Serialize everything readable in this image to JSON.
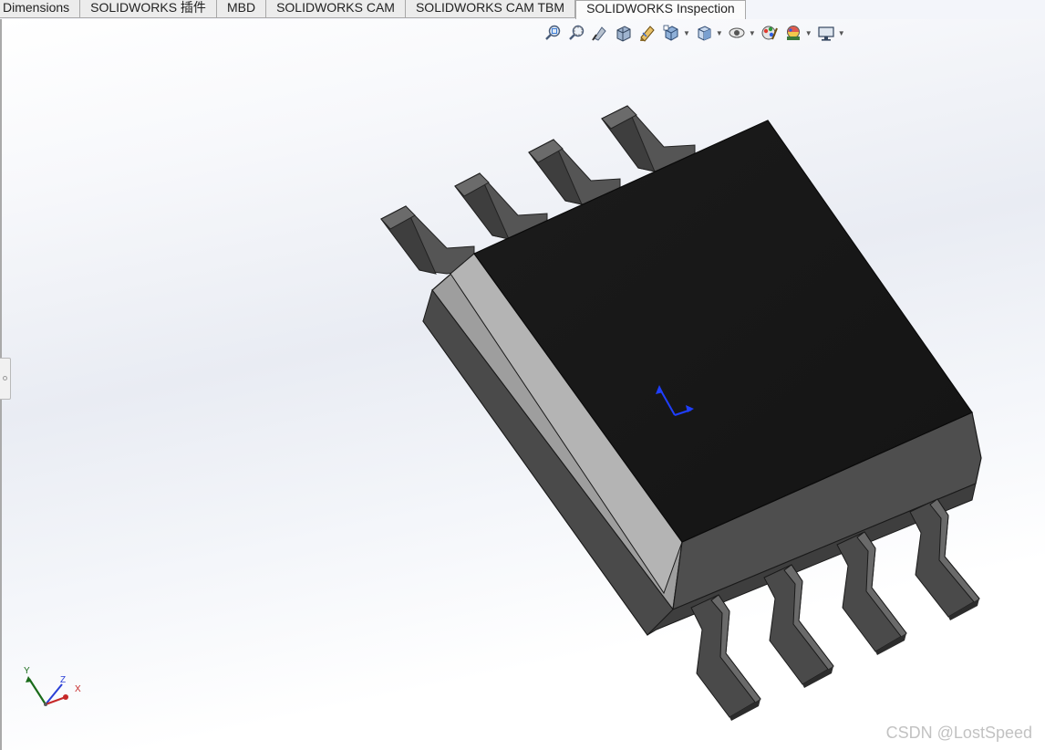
{
  "tabs": [
    {
      "label": "Dimensions",
      "active": false
    },
    {
      "label": "SOLIDWORKS 插件",
      "active": false
    },
    {
      "label": "MBD",
      "active": false
    },
    {
      "label": "SOLIDWORKS CAM",
      "active": false
    },
    {
      "label": "SOLIDWORKS CAM TBM",
      "active": false
    },
    {
      "label": "SOLIDWORKS Inspection",
      "active": true
    }
  ],
  "toolbar": [
    {
      "icon": "zoom-to-fit-icon"
    },
    {
      "icon": "zoom-to-area-icon"
    },
    {
      "icon": "previous-view-icon"
    },
    {
      "icon": "section-view-icon"
    },
    {
      "icon": "dynamic-annotation-icon"
    },
    {
      "icon": "view-orientation-icon",
      "dropdown": true
    },
    {
      "icon": "display-style-icon",
      "dropdown": true
    },
    {
      "icon": "hide-show-items-icon",
      "dropdown": true
    },
    {
      "icon": "edit-appearance-icon"
    },
    {
      "icon": "apply-scene-icon",
      "dropdown": true
    },
    {
      "icon": "view-settings-icon",
      "dropdown": true
    }
  ],
  "triad": {
    "x": "X",
    "y": "Y",
    "z": "Z"
  },
  "watermark": "CSDN @LostSpeed",
  "colors": {
    "package_top": "#161616",
    "package_side_light": "#aaaaaa",
    "package_side_dark": "#5a5a5a",
    "pin": "#4a4a4a",
    "origin_axes": "#1f3fff"
  }
}
